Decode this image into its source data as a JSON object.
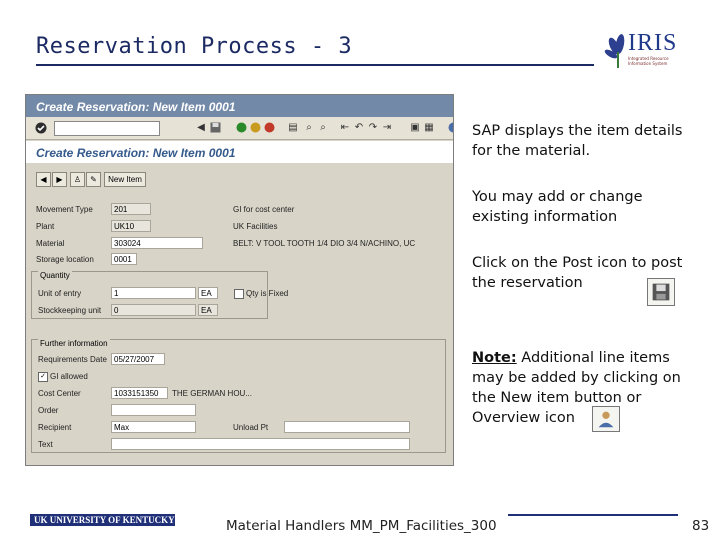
{
  "slide": {
    "title": "Reservation Process - 3",
    "logo_text": "IRIS",
    "logo_subtext": "Integrated Resource Information System",
    "footer_logo": "UK UNIVERSITY OF KENTUCKY",
    "footer_text": "Material Handlers MM_PM_Facilities_300",
    "page_number": "83"
  },
  "sap": {
    "window_title": "Create Reservation: New Item 0001",
    "screen_title": "Create Reservation: New Item 0001",
    "new_item_label": "New Item",
    "fields": {
      "movement_type": {
        "label": "Movement Type",
        "value": "201"
      },
      "gl_cost_center": {
        "label": "GI for cost center"
      },
      "plant": {
        "label": "Plant",
        "value": "UK10"
      },
      "plant_desc": {
        "value": "UK Facilities"
      },
      "material": {
        "label": "Material",
        "value": "303024"
      },
      "material_desc": {
        "value": "BELT: V TOOL TOOTH 1/4 DIO 3/4 N/ACHINO, UC"
      },
      "storage_location": {
        "label": "Storage location",
        "value": "0001"
      }
    },
    "quantity_group": {
      "title": "Quantity",
      "unit_of_entry": {
        "label": "Unit of entry",
        "value": "1",
        "unit": "EA"
      },
      "qty_is_fixed": {
        "label": "Qty is Fixed"
      },
      "stockkeeping_unit": {
        "label": "Stockkeeping unit",
        "value": "0",
        "unit": "EA"
      }
    },
    "further_group": {
      "title": "Further information",
      "requirements_date": {
        "label": "Requirements Date",
        "value": "05/27/2007"
      },
      "gr_allowed": {
        "label": "GI allowed"
      },
      "cost_center": {
        "label": "Cost Center",
        "value": "1033151350",
        "desc": "THE GERMAN HOU..."
      },
      "order": {
        "label": "Order"
      },
      "recipient": {
        "label": "Recipient",
        "value": "Max",
        "unload_label": "Unload Pt"
      },
      "text": {
        "label": "Text"
      }
    }
  },
  "instructions": {
    "p1": "SAP displays the item details for the material.",
    "p2": "You may add or change existing information",
    "p3": "Click on the Post icon to post the reservation",
    "note_label": "Note:",
    "p4": " Additional line items may be added by clicking on the New item button or Overview icon",
    "icons": [
      "save-icon",
      "overview-icon"
    ]
  }
}
